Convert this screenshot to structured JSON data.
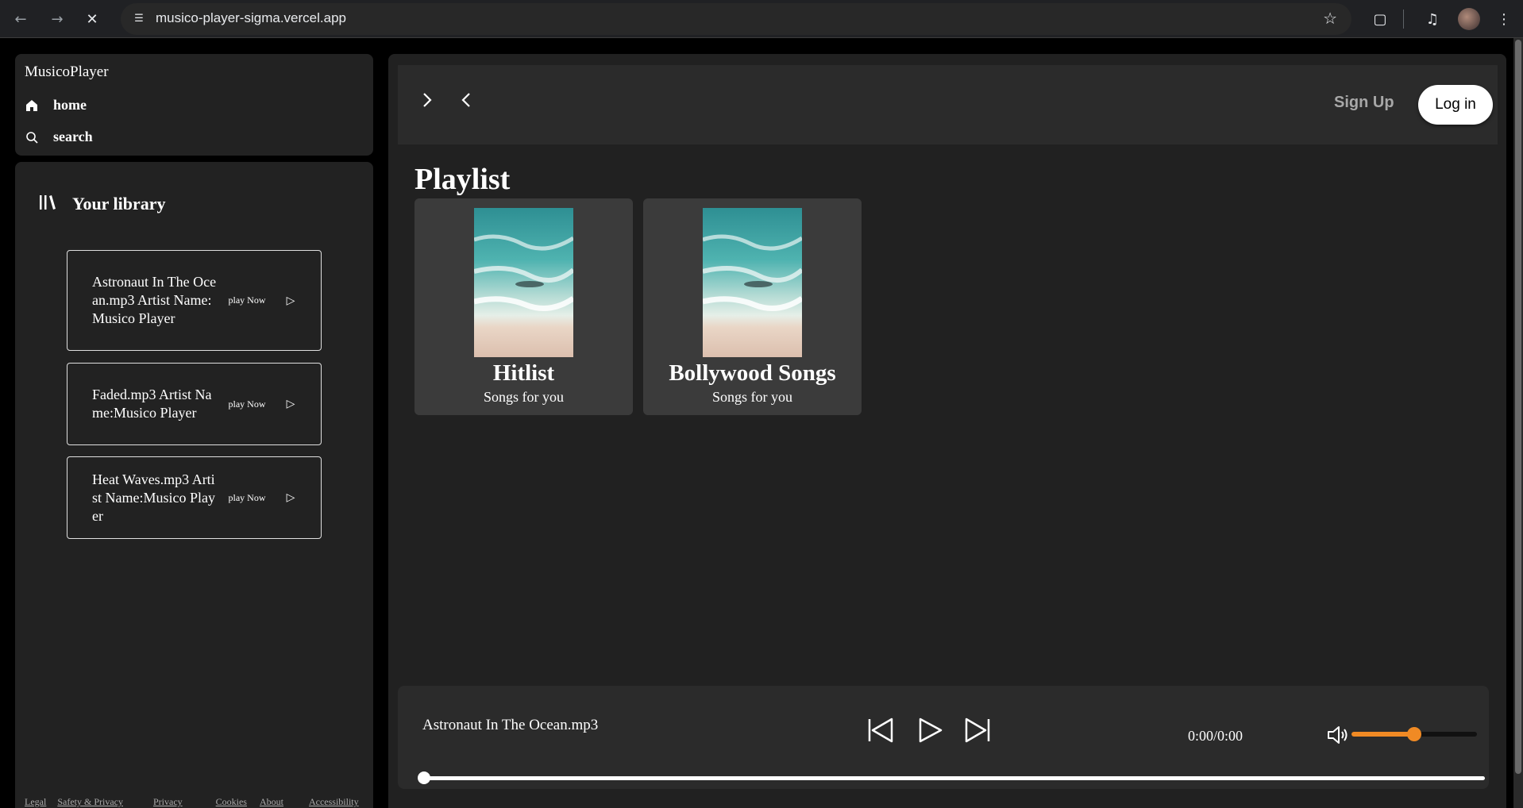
{
  "browser": {
    "url": "musico-player-sigma.vercel.app",
    "icons": [
      "back-icon",
      "forward-icon",
      "stop-loading-icon",
      "site-info-icon",
      "bookmark-star-icon",
      "extensions-icon",
      "media-control-icon",
      "profile-avatar",
      "menu-icon"
    ]
  },
  "sidebar": {
    "brand": "MusicoPlayer",
    "nav": [
      {
        "label": "home",
        "icon": "home-icon"
      },
      {
        "label": "search",
        "icon": "search-icon"
      }
    ]
  },
  "library": {
    "title": "Your library",
    "songs": [
      {
        "info": "Astronaut In The Ocean.mp3 Artist Name:Musico Player",
        "play_label": "play Now"
      },
      {
        "info": "Faded.mp3 Artist Name:Musico Player",
        "play_label": "play Now"
      },
      {
        "info": "Heat Waves.mp3 Artist Name:Musico Player",
        "play_label": "play Now"
      }
    ],
    "footer_links": [
      "Legal",
      "Safety & Privacy",
      "Privacy",
      "Cookies",
      "About",
      "Accessibility"
    ]
  },
  "header": {
    "signup_label": "Sign Up",
    "login_label": "Log in"
  },
  "playlist": {
    "title": "Playlist",
    "cards": [
      {
        "title": "Hitlist",
        "subtitle": "Songs for you"
      },
      {
        "title": "Bollywood Songs",
        "subtitle": "Songs for you"
      }
    ]
  },
  "player": {
    "now_playing": "Astronaut In The Ocean.mp3",
    "time": "0:00/0:00",
    "volume_fraction": 0.5,
    "progress_fraction": 0,
    "accent_color": "#f08a24"
  }
}
